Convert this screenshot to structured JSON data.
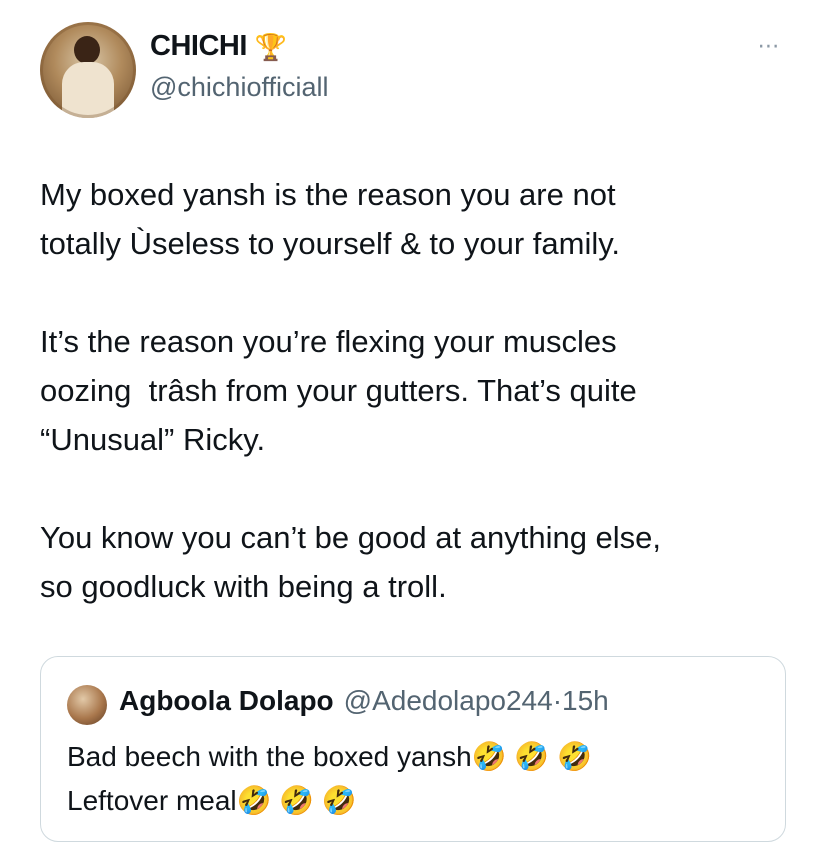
{
  "author": {
    "display_name": "CHICHI",
    "badge_emoji": "🏆",
    "handle": "@chichiofficiall"
  },
  "more_icon": "⋯",
  "tweet": {
    "paragraphs": [
      "My boxed yansh is the reason you are not\ntotally Ùseless to yourself & to your family.",
      "It’s the reason you’re flexing your muscles\noozing  trâsh from your gutters. That’s quite\n“Unusual” Ricky.",
      "You know you can’t be good at anything else,\nso goodluck with being a troll."
    ]
  },
  "quoted_tweet": {
    "display_name": "Agboola Dolapo",
    "handle": "@Adedolapo244",
    "separator": "·",
    "time": "15h",
    "text": "Bad beech with the boxed yansh🤣 🤣 🤣\nLeftover meal🤣 🤣 🤣"
  }
}
